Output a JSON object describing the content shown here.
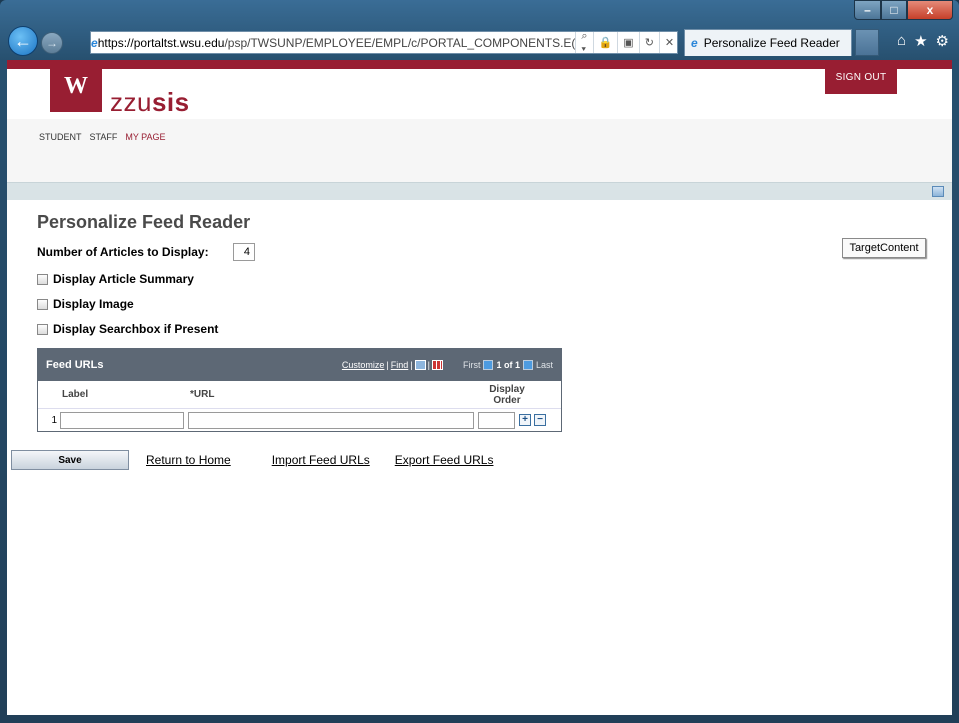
{
  "browser": {
    "url": "https://portaltst.wsu.edu/psp/TWSUNP/EMPLOYEE/EMPL/c/PORTAL_COMPONENTS.E(",
    "url_https": "https://",
    "url_host": "portaltst.wsu.edu",
    "url_path": "/psp/TWSUNP/EMPLOYEE/EMPL/c/PORTAL_COMPONENTS.E(",
    "tab_title": "Personalize Feed Reader",
    "window_controls": {
      "minimize": "–",
      "maximize": "□",
      "close": "x"
    },
    "icons": [
      "home-icon",
      "favorites-star-icon",
      "tools-gear-icon"
    ]
  },
  "header": {
    "logo_text": "zzusis",
    "logo_prefix": "zzu",
    "logo_suffix": "sis",
    "sign_out": "SIGN OUT"
  },
  "menu": {
    "items": [
      {
        "label": "STUDENT",
        "active": false
      },
      {
        "label": "STAFF",
        "active": false
      },
      {
        "label": "MY PAGE",
        "active": true
      }
    ]
  },
  "page": {
    "title": "Personalize Feed Reader",
    "num_articles_label": "Number of Articles to Display:",
    "num_articles_value": "4",
    "options": [
      {
        "label": "Display Article Summary",
        "checked": false
      },
      {
        "label": "Display Image",
        "checked": false
      },
      {
        "label": "Display Searchbox if Present",
        "checked": false
      }
    ],
    "target_content": "TargetContent"
  },
  "grid": {
    "title": "Feed URLs",
    "customize": "Customize",
    "find": "Find",
    "first": "First",
    "page_info": "1 of 1",
    "last": "Last",
    "columns": {
      "label": "Label",
      "url": "*URL",
      "display_order": "Display Order"
    },
    "rows": [
      {
        "num": "1",
        "label": "",
        "url": "",
        "order": ""
      }
    ]
  },
  "actions": {
    "save": "Save",
    "return_home": "Return to Home",
    "import": "Import Feed URLs",
    "export": "Export Feed URLs"
  }
}
